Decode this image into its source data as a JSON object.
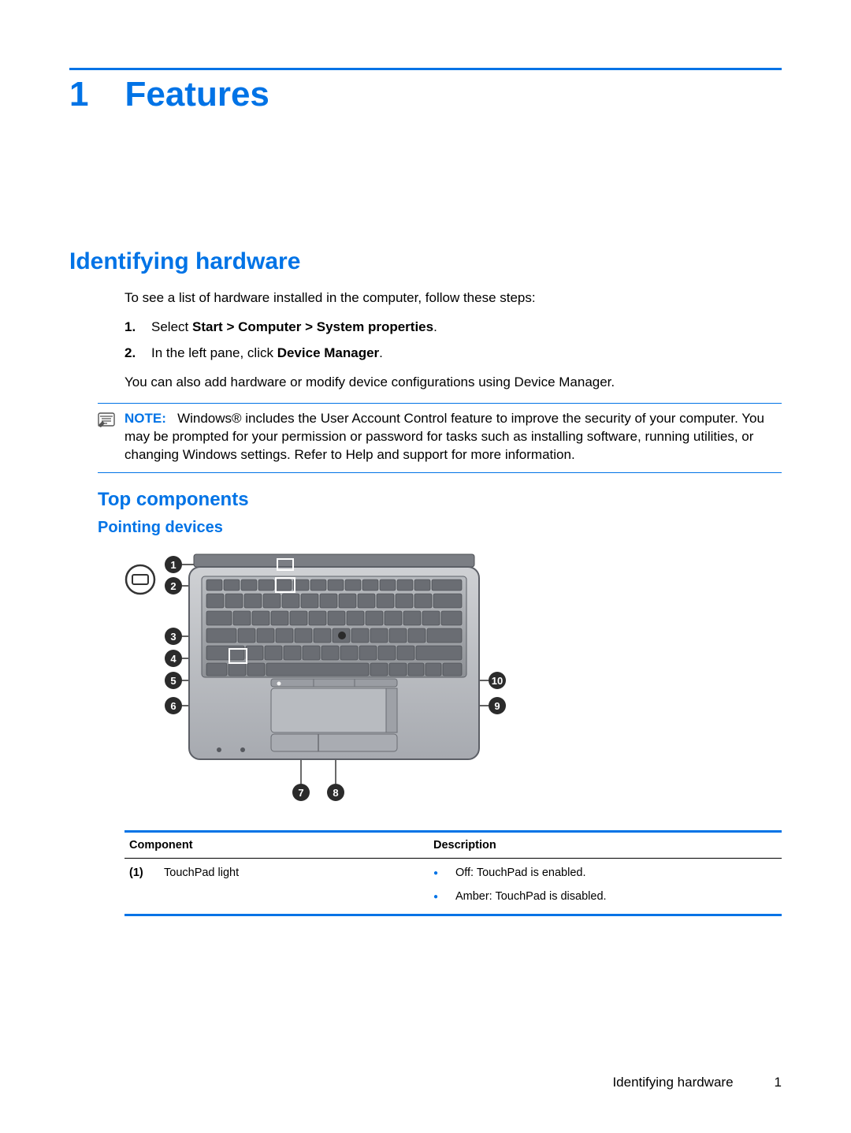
{
  "chapter": {
    "num": "1",
    "title": "Features"
  },
  "section": {
    "title": "Identifying hardware"
  },
  "intro": "To see a list of hardware installed in the computer, follow these steps:",
  "steps": [
    {
      "num": "1.",
      "pre": "Select ",
      "bold": "Start > Computer > System properties",
      "post": "."
    },
    {
      "num": "2.",
      "pre": "In the left pane, click ",
      "bold": "Device Manager",
      "post": "."
    }
  ],
  "after_steps": "You can also add hardware or modify device configurations using Device Manager.",
  "note": {
    "label": "NOTE:",
    "text": "Windows® includes the User Account Control feature to improve the security of your computer. You may be prompted for your permission or password for tasks such as installing software, running utilities, or changing Windows settings. Refer to Help and support for more information."
  },
  "subsection": {
    "title": "Top components"
  },
  "subsubsection": {
    "title": "Pointing devices"
  },
  "callouts": [
    "1",
    "2",
    "3",
    "4",
    "5",
    "6",
    "7",
    "8",
    "9",
    "10"
  ],
  "table": {
    "headers": {
      "component": "Component",
      "description": "Description"
    },
    "rows": [
      {
        "idx": "(1)",
        "component": "TouchPad light",
        "bullets": [
          "Off: TouchPad is enabled.",
          "Amber: TouchPad is disabled."
        ]
      }
    ]
  },
  "footer": {
    "section": "Identifying hardware",
    "page": "1"
  }
}
